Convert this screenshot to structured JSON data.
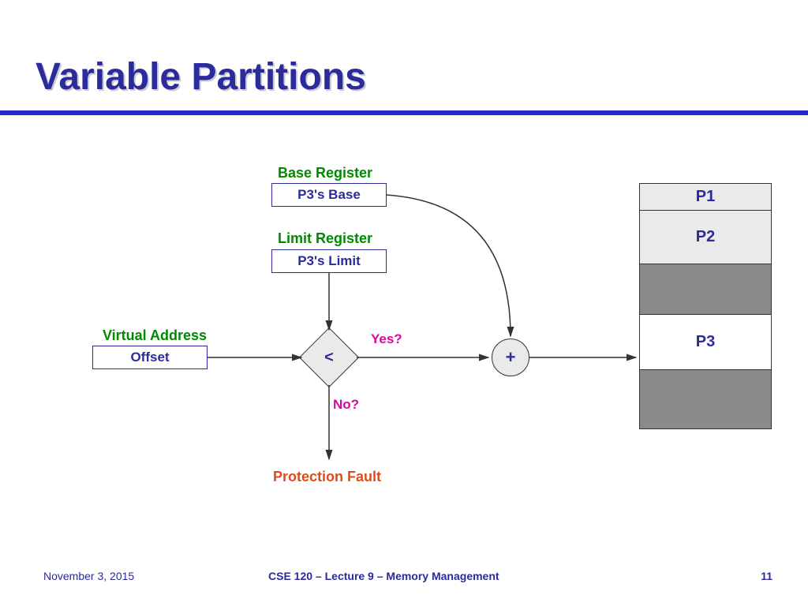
{
  "title": "Variable Partitions",
  "labels": {
    "base_register": "Base Register",
    "limit_register": "Limit Register",
    "virtual_address": "Virtual Address",
    "yes": "Yes?",
    "no": "No?",
    "protection_fault": "Protection Fault"
  },
  "boxes": {
    "base": "P3's Base",
    "limit": "P3's Limit",
    "offset": "Offset"
  },
  "operators": {
    "compare": "<",
    "add": "+"
  },
  "partitions": {
    "p1": "P1",
    "p2": "P2",
    "p3": "P3"
  },
  "footer": {
    "date": "November 3, 2015",
    "course": "CSE 120 – Lecture 9 – Memory Management",
    "page": "11"
  }
}
